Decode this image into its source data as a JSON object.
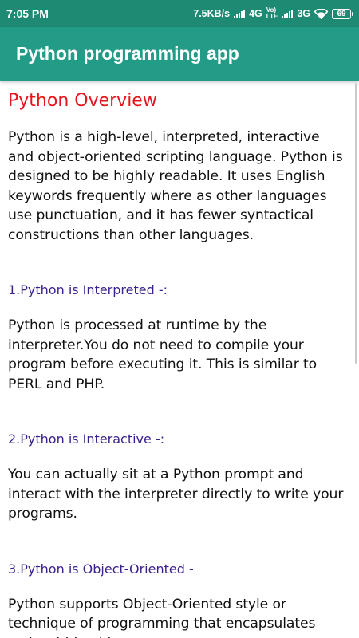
{
  "status_bar": {
    "time": "7:05 PM",
    "speed": "7.5KB/s",
    "network_4g": "4G",
    "volte_top": "Vo)",
    "volte_bottom": "LTE",
    "network_3g": "3G",
    "battery": "69"
  },
  "app_bar": {
    "title": "Python programming app"
  },
  "content": {
    "title": "Python Overview",
    "intro": "Python is a high-level, interpreted, interactive and object-oriented scripting language. Python is designed to be highly readable. It uses English keywords frequently where as other languages use punctuation, and it has fewer syntactical constructions than other languages.",
    "sections": [
      {
        "heading": "1.Python is Interpreted -:",
        "body": "Python is processed at runtime by the interpreter.You do not need to compile your program before executing it. This is similar to PERL and PHP."
      },
      {
        "heading": "2.Python is Interactive -:",
        "body": "You can actually sit at a Python prompt and interact with the interpreter directly to write your programs."
      },
      {
        "heading": "3.Python is Object-Oriented -",
        "body": "Python supports Object-Oriented style or technique of programming that encapsulates code within objects."
      }
    ]
  },
  "colors": {
    "status_bar": "#1f8a74",
    "app_bar": "#229c86",
    "title_red": "#e8141c",
    "heading_purple": "#3a1f8f"
  }
}
